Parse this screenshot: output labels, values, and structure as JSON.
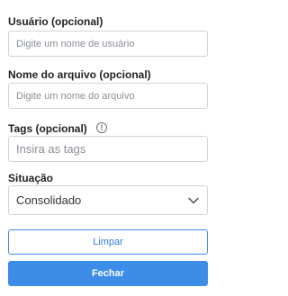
{
  "fields": {
    "user": {
      "label": "Usuário (opcional)",
      "placeholder": "Digite um nome de usuário"
    },
    "filename": {
      "label": "Nome do arquivo (opcional)",
      "placeholder": "Digite um nome do arquivo"
    },
    "tags": {
      "label": "Tags (opcional)",
      "placeholder": "Insira as tags",
      "info_icon": "info-icon"
    },
    "status": {
      "label": "Situação",
      "value": "Consolidado",
      "icon": "chevron-down-icon"
    }
  },
  "buttons": {
    "clear": "Limpar",
    "close": "Fechar"
  },
  "colors": {
    "accent": "#3d8de8",
    "border": "#cfd4da"
  }
}
